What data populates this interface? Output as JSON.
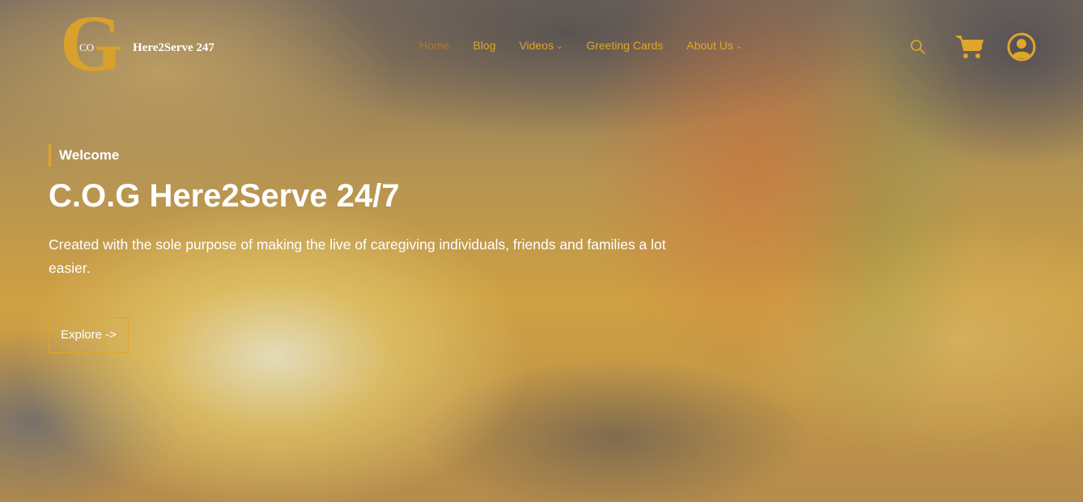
{
  "logo": {
    "letter": "G",
    "prefix": "CO",
    "name": "Here2Serve 247"
  },
  "nav": {
    "items": [
      {
        "label": "Home"
      },
      {
        "label": "Blog"
      },
      {
        "label": "Videos",
        "chevron": "⌄"
      },
      {
        "label": "Greeting Cards"
      },
      {
        "label": "About Us",
        "chevron": "⌄"
      }
    ]
  },
  "icons": {
    "search": "search-icon",
    "cart": "cart-icon",
    "account": "user-account-icon"
  },
  "hero": {
    "kicker": "Welcome",
    "title": "C.O.G Here2Serve 24/7",
    "description": "Created with the sole purpose of making the live of caregiving individuals, friends and families a lot easier.",
    "cta_label": "Explore ->"
  },
  "colors": {
    "accent": "#e0a52b",
    "logo_gold": "#d7a12b",
    "active_nav": "#a77a2a",
    "text": "#ffffff"
  }
}
